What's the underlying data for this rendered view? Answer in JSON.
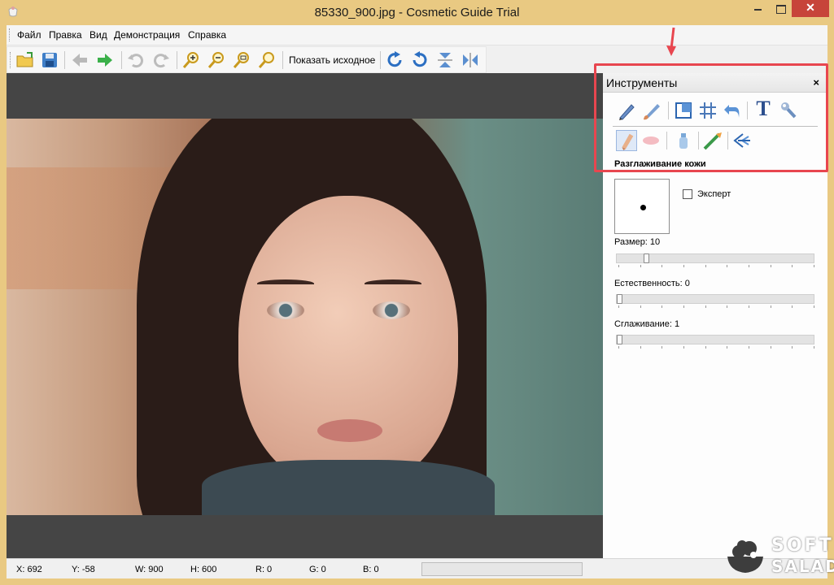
{
  "window": {
    "title": "85330_900.jpg - Cosmetic Guide Trial",
    "close_glyph": "✕"
  },
  "menu": {
    "items": [
      "Файл",
      "Правка",
      "Вид",
      "Демонстрация",
      "Справка"
    ]
  },
  "toolbar": {
    "icons": [
      "open-folder-icon",
      "save-icon",
      "back-arrow-icon",
      "forward-arrow-icon",
      "undo-icon",
      "redo-icon",
      "zoom-in-icon",
      "zoom-out-icon",
      "zoom-fit-icon",
      "zoom-actual-icon",
      "rotate-right-icon",
      "rotate-left-icon",
      "flip-vertical-icon",
      "flip-horizontal-icon"
    ],
    "show_original_label": "Показать исходное"
  },
  "tools_panel": {
    "title": "Инструменты",
    "close_glyph": "×",
    "row1_icons": [
      "pencil-icon",
      "brush-icon",
      "crop-icon",
      "grid-icon",
      "undo-arrow-icon",
      "text-tool-icon",
      "wrench-icon"
    ],
    "row2_icons": [
      "skin-smoothing-icon",
      "lips-icon",
      "bottle-icon",
      "toothbrush-icon",
      "back-tool-icon"
    ],
    "active_tool_index": 0,
    "section_title": "Разглаживание кожи",
    "text_tool_glyph": "T",
    "expert_label": "Эксперт",
    "expert_checked": false,
    "size_label": "Размер: 10",
    "naturalness_label": "Естественность: 0",
    "smoothing_label": "Сглаживание: 1",
    "size_fraction": 0.14,
    "naturalness_fraction": 0.0,
    "smoothing_fraction": 0.0
  },
  "status": {
    "x": "X: 692",
    "y": "Y: -58",
    "w": "W: 900",
    "h": "H: 600",
    "r": "R: 0",
    "g": "G: 0",
    "b": "B: 0"
  },
  "watermark": {
    "line1": "SOFT",
    "line2": "SALAD"
  },
  "colors": {
    "frame": "#e9c982",
    "close_button": "#c7443a",
    "highlight": "#e8464f",
    "canvas": "#454545"
  }
}
